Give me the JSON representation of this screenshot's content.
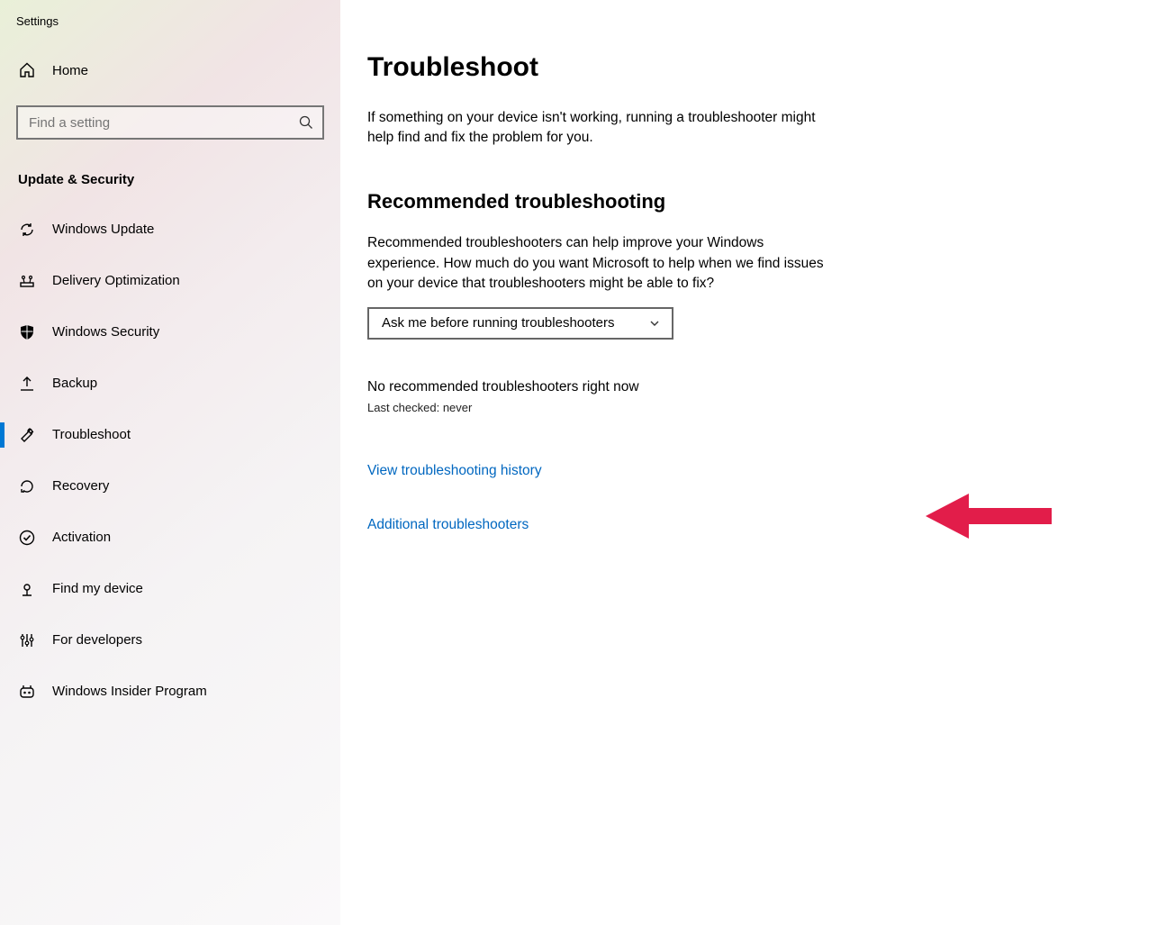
{
  "app_title": "Settings",
  "home_label": "Home",
  "search_placeholder": "Find a setting",
  "category": "Update & Security",
  "sidebar": {
    "items": [
      {
        "label": "Windows Update"
      },
      {
        "label": "Delivery Optimization"
      },
      {
        "label": "Windows Security"
      },
      {
        "label": "Backup"
      },
      {
        "label": "Troubleshoot"
      },
      {
        "label": "Recovery"
      },
      {
        "label": "Activation"
      },
      {
        "label": "Find my device"
      },
      {
        "label": "For developers"
      },
      {
        "label": "Windows Insider Program"
      }
    ]
  },
  "main": {
    "title": "Troubleshoot",
    "lead": "If something on your device isn't working, running a troubleshooter might help find and fix the problem for you.",
    "recommended_title": "Recommended troubleshooting",
    "recommended_desc": "Recommended troubleshooters can help improve your Windows experience. How much do you want Microsoft to help when we find issues on your device that troubleshooters might be able to fix?",
    "dropdown_value": "Ask me before running troubleshooters",
    "none_text": "No recommended troubleshooters right now",
    "last_checked": "Last checked: never",
    "link_history": "View troubleshooting history",
    "link_additional": "Additional troubleshooters"
  }
}
